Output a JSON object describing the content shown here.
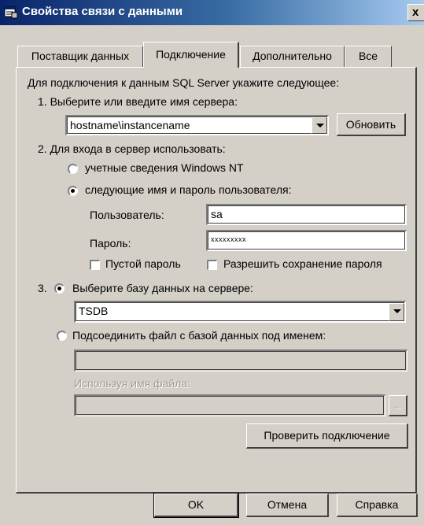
{
  "window": {
    "title": "Свойства связи с данными",
    "close_glyph": "x",
    "title_icon": "data-link-icon"
  },
  "tabs": [
    {
      "label": "Поставщик данных",
      "active": false
    },
    {
      "label": "Подключение",
      "active": true
    },
    {
      "label": "Дополнительно",
      "active": false
    },
    {
      "label": "Все",
      "active": false
    }
  ],
  "connection": {
    "intro": "Для подключения к данным SQL Server укажите следующее:",
    "step1_label": "1. Выберите или введите имя сервера:",
    "server_value": "hostname\\instancename",
    "refresh_label": "Обновить",
    "step2_label": "2. Для входа в сервер использовать:",
    "auth_windows_label": "учетные сведения Windows NT",
    "auth_windows_checked": false,
    "auth_sql_label": "следующие имя и пароль пользователя:",
    "auth_sql_checked": true,
    "user_label": "Пользователь:",
    "user_value": "sa",
    "password_label": "Пароль:",
    "password_value": "xxxxxxxxx",
    "blank_password_label": "Пустой пароль",
    "blank_password_checked": false,
    "save_password_label": "Разрешить сохранение пароля",
    "save_password_checked": false,
    "step3_number": "3.",
    "select_db_label": "Выберите базу данных на сервере:",
    "select_db_checked": true,
    "database_value": "TSDB",
    "attach_file_label": "Подсоединить файл с базой данных под именем:",
    "attach_file_checked": false,
    "attach_file_value": "",
    "using_filename_label": "Используя имя файла:",
    "filename_value": "",
    "browse_label": "...",
    "test_connection_label": "Проверить подключение"
  },
  "footer": {
    "ok_label": "OK",
    "cancel_label": "Отмена",
    "help_label": "Справка"
  },
  "colors": {
    "titlebar_start": "#0a246a",
    "titlebar_end": "#a6caf0",
    "face": "#d4d0c8"
  }
}
